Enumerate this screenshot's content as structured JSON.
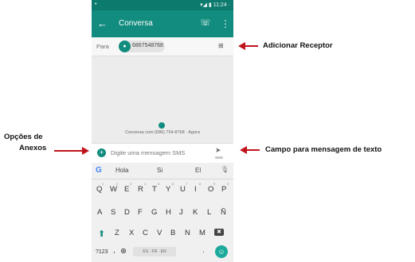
{
  "colors": {
    "status_bar": "#0d7a6e",
    "app_bar": "#128c7e",
    "accent": "#128c7e",
    "arrow": "#c0141b"
  },
  "status": {
    "left_icon": "•",
    "time": "▾◢ ▮ 11:24 ·"
  },
  "appbar": {
    "back_icon": "back-arrow-icon",
    "back_glyph": "←",
    "title": "Conversa",
    "call_glyph": "☏",
    "more_glyph": "⋮"
  },
  "recipient": {
    "label": "Para",
    "avatar_glyph": "●",
    "number": "6867548768",
    "add_glyph": "⊞"
  },
  "conversation": {
    "info": "Conversa com (686) 754-8768 · Agora"
  },
  "composer": {
    "plus_glyph": "+",
    "placeholder": "Digite uma mensagem SMS",
    "send_glyph": "➤",
    "send_label": "SMS"
  },
  "keyboard": {
    "google_glyph": "G",
    "suggestions": [
      "Hola",
      "Si",
      "El"
    ],
    "mic_glyph": "🎙",
    "row1": [
      "Q",
      "W",
      "E",
      "R",
      "T",
      "Y",
      "U",
      "I",
      "O",
      "P"
    ],
    "row1_sup": [
      "1",
      "2",
      "3",
      "4",
      "5",
      "6",
      "7",
      "8",
      "9",
      "0"
    ],
    "row2": [
      "A",
      "S",
      "D",
      "F",
      "G",
      "H",
      "J",
      "K",
      "L",
      "Ñ"
    ],
    "row3": [
      "Z",
      "X",
      "C",
      "V",
      "B",
      "N",
      "M"
    ],
    "shift_glyph": "⬆",
    "backspace_glyph": "✖",
    "sym_label": "?123",
    "comma": ",",
    "globe_glyph": "⊕",
    "space_label": "ES · FR · EN",
    "period": ".",
    "enter_glyph": "☺"
  },
  "callouts": {
    "add_receiver": "Adicionar Receptor",
    "attach_line1": "Opções de",
    "attach_line2": "Anexos",
    "text_field": "Campo para mensagem de texto"
  }
}
